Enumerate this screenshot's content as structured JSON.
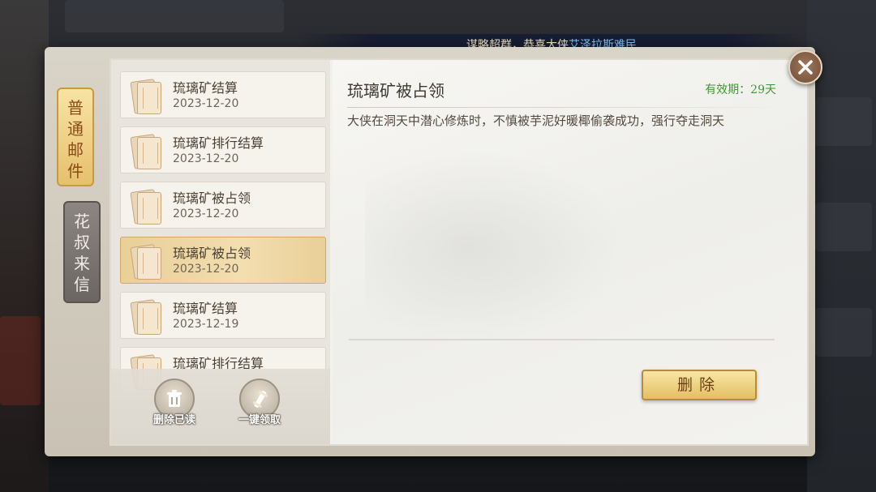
{
  "announcement": {
    "prefix": "谋略超群，恭喜大侠",
    "name": "艾泽拉斯难民"
  },
  "tabs": [
    {
      "label_chars": [
        "普",
        "通",
        "邮",
        "件"
      ],
      "active": true
    },
    {
      "label_chars": [
        "花",
        "叔",
        "来",
        "信"
      ],
      "active": false
    }
  ],
  "mails": [
    {
      "title": "琉璃矿结算",
      "date": "2023-12-20"
    },
    {
      "title": "琉璃矿排行结算",
      "date": "2023-12-20"
    },
    {
      "title": "琉璃矿被占领",
      "date": "2023-12-20"
    },
    {
      "title": "琉璃矿被占领",
      "date": "2023-12-20",
      "selected": true
    },
    {
      "title": "琉璃矿结算",
      "date": "2023-12-19"
    },
    {
      "title": "琉璃矿排行结算",
      "date": ""
    }
  ],
  "list_actions": {
    "delete_read_label": "删除已读",
    "claim_all_label": "一键领取"
  },
  "detail": {
    "title": "琉璃矿被占领",
    "validity": "有效期：29天",
    "body": "大侠在洞天中潜心修炼时，不慎被芋泥好暖椰偷袭成功，强行夺走洞天",
    "delete_label": "删除"
  },
  "colors": {
    "accent_gold": "#e3bf62",
    "validity_green": "#3d9a33",
    "announcement_highlight": "#7fc6ff"
  }
}
